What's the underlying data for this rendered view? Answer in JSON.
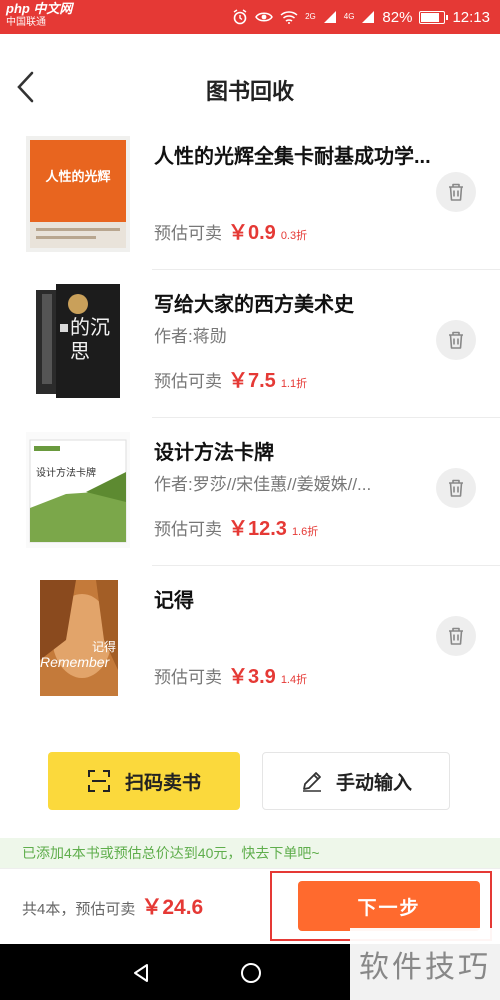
{
  "status_bar": {
    "watermark": "php 中文网",
    "carrier": "中国联通",
    "signal_tags": [
      "2G",
      "4G"
    ],
    "battery_level": "82%",
    "time": "12:13",
    "icons": [
      "alarm-icon",
      "eye-icon",
      "wifi-icon",
      "signal-icon",
      "battery-icon"
    ]
  },
  "header": {
    "title": "图书回收",
    "back_icon": "chevron-left-icon"
  },
  "books": [
    {
      "title": "人性的光辉全集卡耐基成功学...",
      "author": "",
      "price_label": "预估可卖",
      "price": "￥0.9",
      "discount": "0.3折",
      "cover": "orange-cover"
    },
    {
      "title": "写给大家的西方美术史",
      "author": "作者:蒋勋",
      "price_label": "预估可卖",
      "price": "￥7.5",
      "discount": "1.1折",
      "cover": "dark-cover"
    },
    {
      "title": "设计方法卡牌",
      "author": "作者:罗莎//宋佳蕙//姜嫒姝//...",
      "price_label": "预估可卖",
      "price": "￥12.3",
      "discount": "1.6折",
      "cover": "green-cover"
    },
    {
      "title": "记得",
      "author": "",
      "price_label": "预估可卖",
      "price": "￥3.9",
      "discount": "1.4折",
      "cover": "remember-cover"
    }
  ],
  "covers": {
    "orange_title": "人性的光辉",
    "dark_chars": "的沉思",
    "green_title": "设计方法卡牌",
    "remember_text": "Remember",
    "remember_cn": "记得"
  },
  "actions": {
    "scan_label": "扫码卖书",
    "manual_label": "手动输入"
  },
  "notice": "已添加4本书或预估总价达到40元，快去下单吧~",
  "bottom": {
    "summary": "共4本，预估可卖",
    "total": "￥24.6",
    "next_label": "下一步"
  },
  "watermark_corner": "软件技巧",
  "colors": {
    "accent_red": "#e53935",
    "orange_button": "#ff6a2e",
    "yellow_button": "#fbd93c",
    "notice_green": "#5fae4c"
  }
}
